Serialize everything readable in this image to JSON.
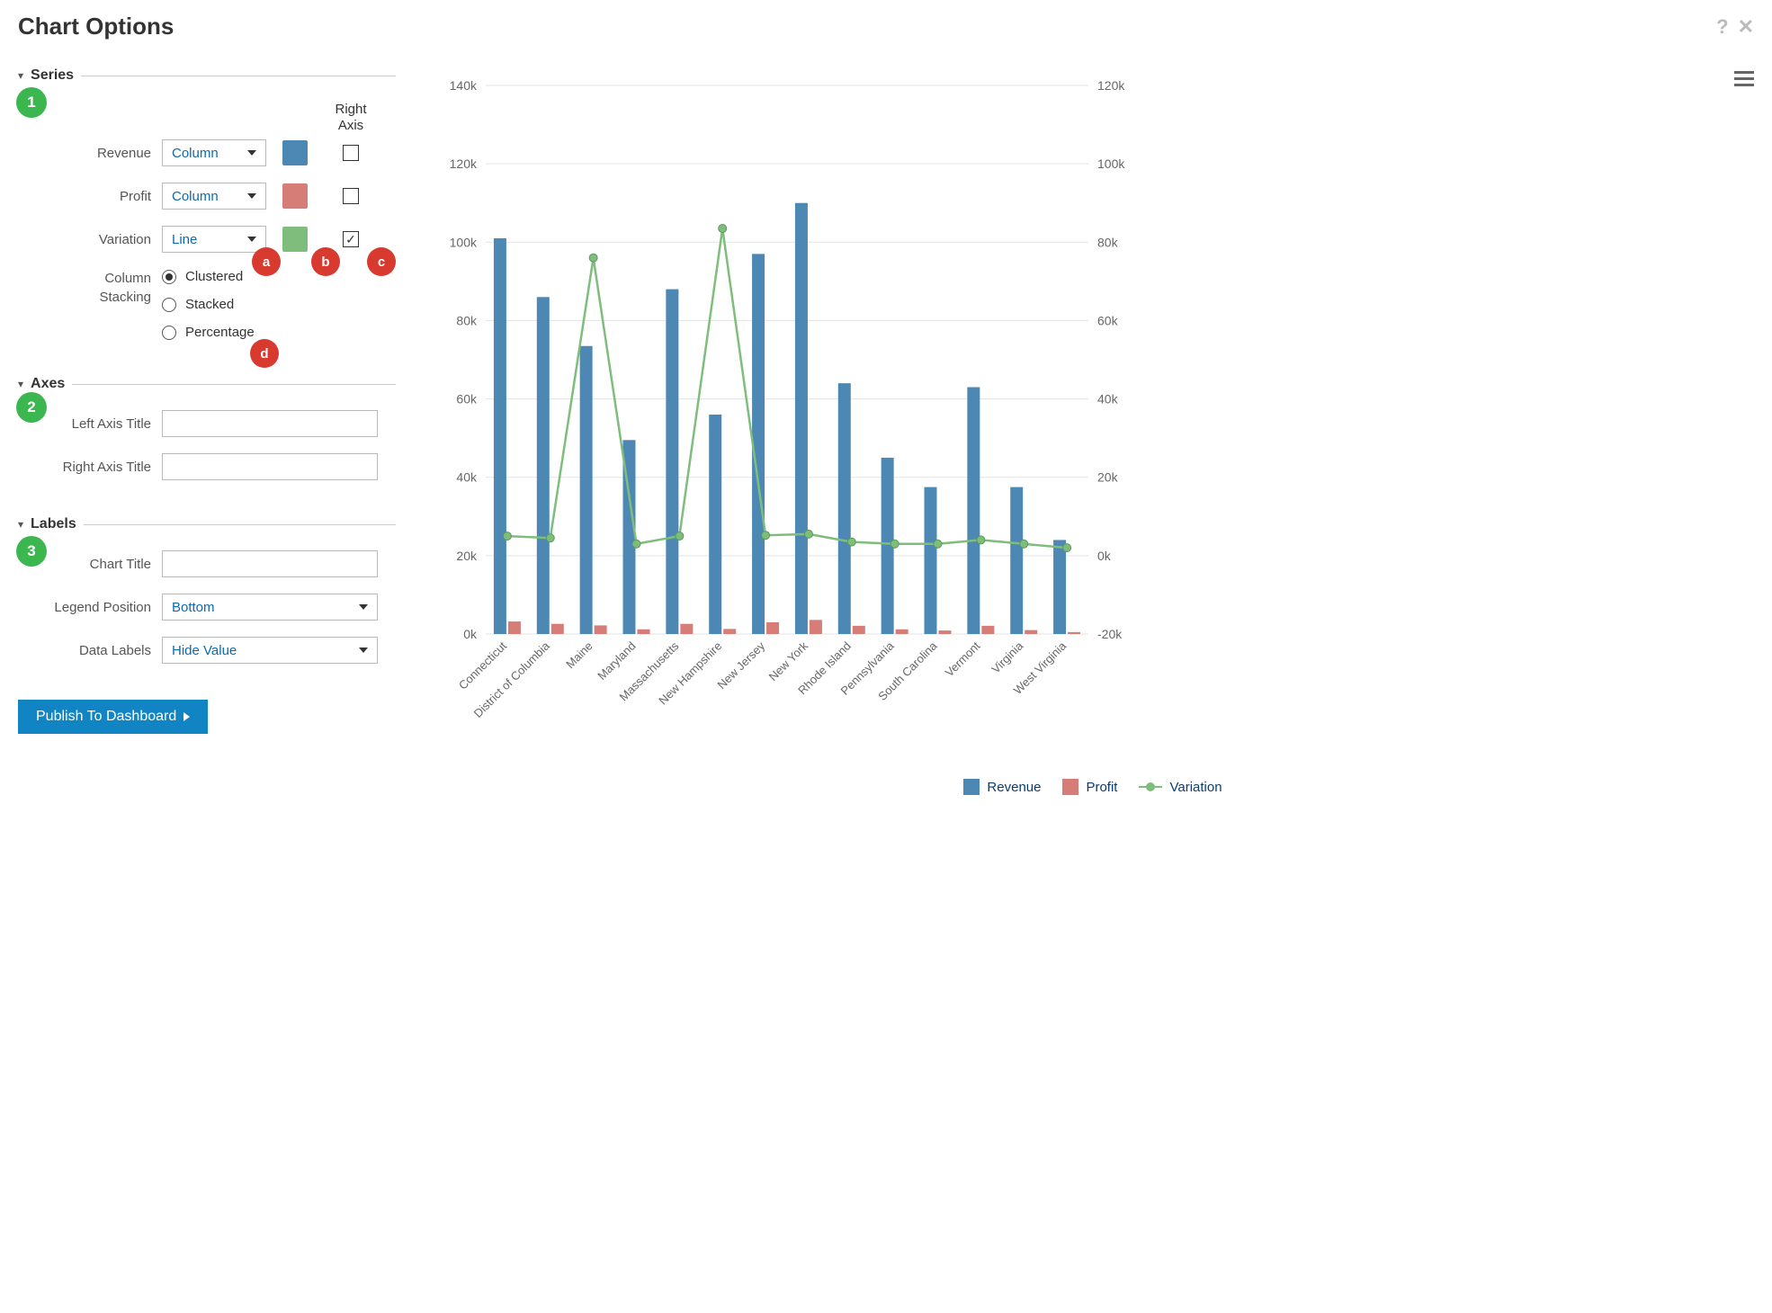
{
  "title": "Chart Options",
  "sections": {
    "series": {
      "label": "Series",
      "badge": "1"
    },
    "axes": {
      "label": "Axes",
      "badge": "2"
    },
    "labels": {
      "label": "Labels",
      "badge": "3"
    }
  },
  "series_config": {
    "right_axis_header1": "Right",
    "right_axis_header2": "Axis",
    "rows": {
      "revenue": {
        "label": "Revenue",
        "type": "Column",
        "color": "#4d88b4",
        "right_axis": false
      },
      "profit": {
        "label": "Profit",
        "type": "Column",
        "color": "#d77d78",
        "right_axis": false
      },
      "variation": {
        "label": "Variation",
        "type": "Line",
        "color": "#7ebd7c",
        "right_axis": true
      }
    },
    "annotations": {
      "a": "a",
      "b": "b",
      "c": "c",
      "d": "d"
    },
    "column_stacking": {
      "label1": "Column",
      "label2": "Stacking",
      "selected": "clustered",
      "options": {
        "clustered": "Clustered",
        "stacked": "Stacked",
        "percentage": "Percentage"
      }
    }
  },
  "axes_config": {
    "left": {
      "label": "Left Axis Title",
      "value": ""
    },
    "right": {
      "label": "Right Axis Title",
      "value": ""
    }
  },
  "labels_config": {
    "chart_title": {
      "label": "Chart Title",
      "value": ""
    },
    "legend_pos": {
      "label": "Legend Position",
      "value": "Bottom"
    },
    "data_labels": {
      "label": "Data Labels",
      "value": "Hide Value"
    }
  },
  "publish_button": "Publish To Dashboard",
  "legend": {
    "revenue": "Revenue",
    "profit": "Profit",
    "variation": "Variation"
  },
  "chart_data": {
    "type": "bar",
    "categories": [
      "Connecticut",
      "District of Columbia",
      "Maine",
      "Maryland",
      "Massachusetts",
      "New Hampshire",
      "New Jersey",
      "New York",
      "Rhode Island",
      "Pennsylvania",
      "South Carolina",
      "Vermont",
      "Virginia",
      "West Virginia"
    ],
    "series": [
      {
        "name": "Revenue",
        "axis": "left",
        "type": "bar",
        "values": [
          101000,
          86000,
          73500,
          49500,
          88000,
          56000,
          97000,
          110000,
          64000,
          45000,
          37500,
          63000,
          37500,
          24000
        ]
      },
      {
        "name": "Profit",
        "axis": "left",
        "type": "bar",
        "values": [
          3200,
          2600,
          2200,
          1200,
          2600,
          1300,
          3000,
          3600,
          2100,
          1200,
          900,
          2100,
          1000,
          500
        ]
      },
      {
        "name": "Variation",
        "axis": "right",
        "type": "line",
        "values": [
          5000,
          4500,
          76000,
          3000,
          5000,
          83500,
          5200,
          5500,
          3500,
          3000,
          3000,
          4000,
          3000,
          2000
        ]
      }
    ],
    "left_axis": {
      "min": 0,
      "max": 140000,
      "step": 20000,
      "ticks": [
        "0k",
        "20k",
        "40k",
        "60k",
        "80k",
        "100k",
        "120k",
        "140k"
      ]
    },
    "right_axis": {
      "min": -20000,
      "max": 120000,
      "step": 20000,
      "ticks": [
        "-20k",
        "0k",
        "20k",
        "40k",
        "60k",
        "80k",
        "100k",
        "120k"
      ]
    },
    "title": "",
    "xlabel": "",
    "ylabel": "",
    "legend_position": "bottom"
  }
}
